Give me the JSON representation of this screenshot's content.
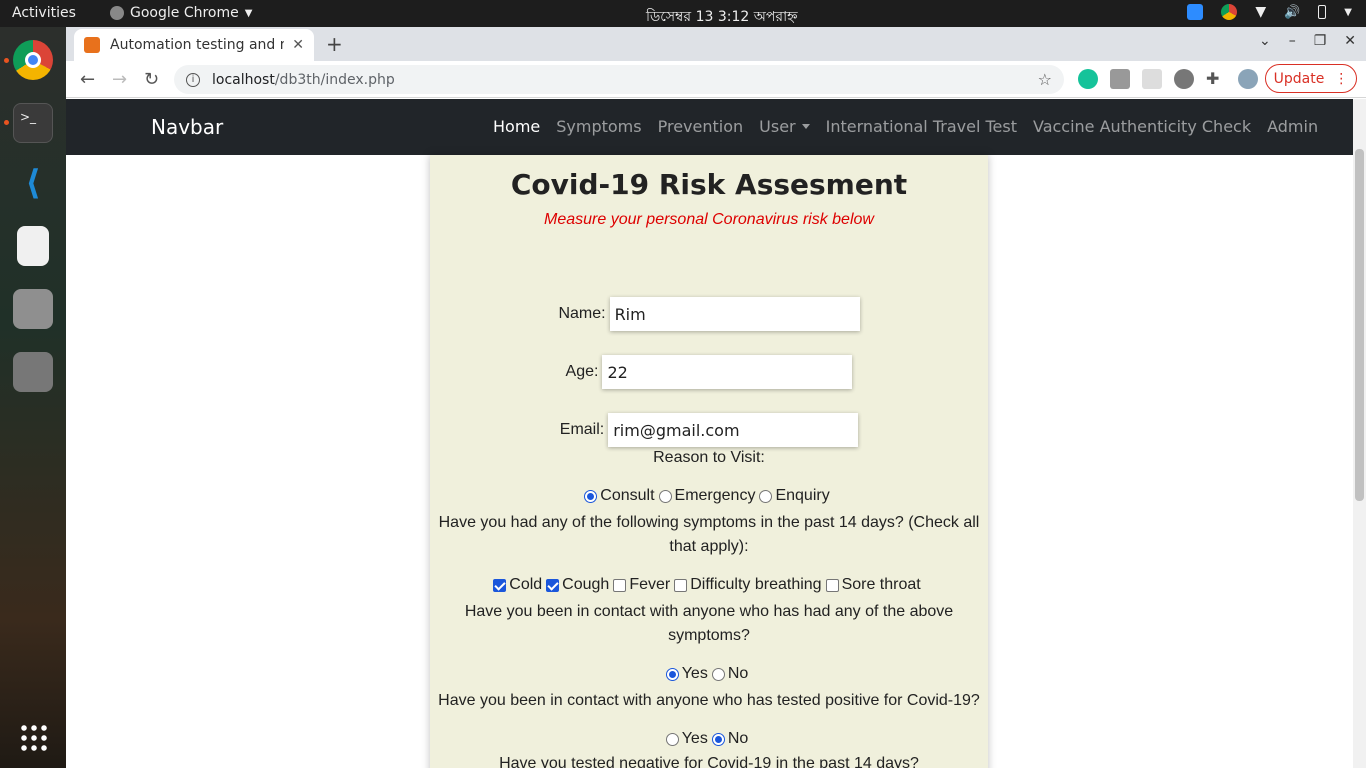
{
  "system": {
    "activities": "Activities",
    "app_name": "Google Chrome",
    "clock": "ডিসেম্বর 13   3:12 অপরাহ্ন"
  },
  "browser": {
    "tab_title": "Automation testing and m",
    "url_host": "localhost",
    "url_path": "/db3th/index.php",
    "update_label": "Update"
  },
  "nav": {
    "brand": "Navbar",
    "links": [
      "Home",
      "Symptoms",
      "Prevention",
      "User",
      "International Travel Test",
      "Vaccine Authenticity Check",
      "Admin"
    ],
    "active": "Home"
  },
  "form": {
    "title": "Covid-19 Risk Assesment",
    "subtitle": "Measure your personal Coronavirus risk below",
    "name_label": "Name:",
    "name_value": "Rim",
    "age_label": "Age:",
    "age_value": "22",
    "email_label": "Email:",
    "email_value": "rim@gmail.com",
    "reason_label": "Reason to Visit:",
    "reason_options": [
      "Consult",
      "Emergency",
      "Enquiry"
    ],
    "reason_selected": "Consult",
    "symptoms_question": "Have you had any of the following symptoms in the past 14 days? (Check all that apply):",
    "symptoms": [
      {
        "label": "Cold",
        "checked": true
      },
      {
        "label": "Cough",
        "checked": true
      },
      {
        "label": "Fever",
        "checked": false
      },
      {
        "label": "Difficulty breathing",
        "checked": false
      },
      {
        "label": "Sore throat",
        "checked": false
      }
    ],
    "contact_question": "Have you been in contact with anyone who has had any of the above symptoms?",
    "contact_yes": "Yes",
    "contact_no": "No",
    "contact_selected": "Yes",
    "positive_question": "Have you been in contact with anyone who has tested positive for Covid-19?",
    "positive_yes": "Yes",
    "positive_no": "No",
    "positive_selected": "No",
    "negative_question": "Have you tested negative for Covid-19 in the past 14 days?"
  }
}
